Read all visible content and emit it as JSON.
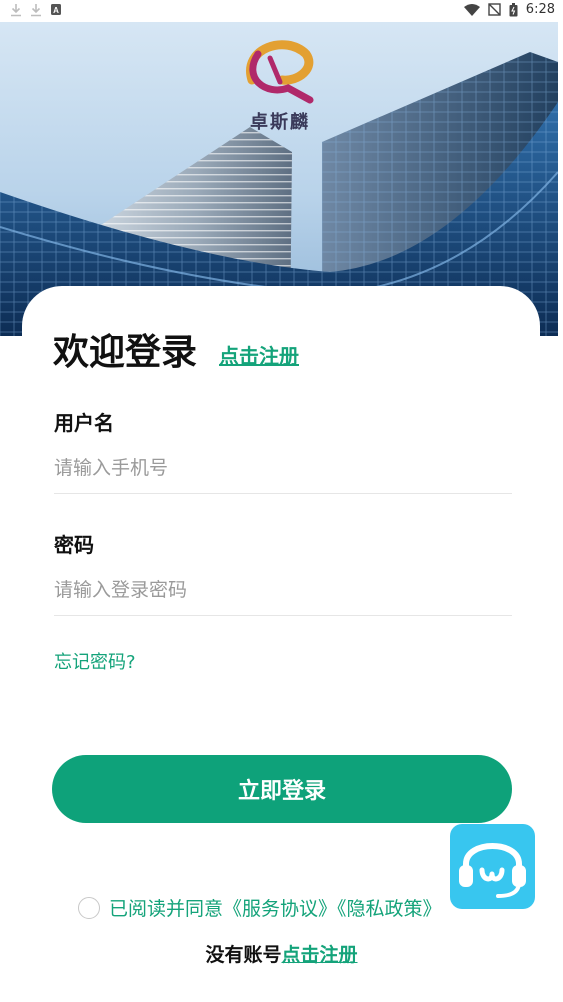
{
  "status_bar": {
    "time": "6:28",
    "left_icons": [
      "download-icon",
      "download-icon",
      "a-notification-icon"
    ],
    "right_icons": [
      "wifi-icon",
      "no-sim-icon",
      "battery-icon"
    ]
  },
  "hero": {
    "brand_name": "卓斯麟"
  },
  "login": {
    "title": "欢迎登录",
    "register_link": "点击注册",
    "username_label": "用户名",
    "username_placeholder": "请输入手机号",
    "password_label": "密码",
    "password_placeholder": "请输入登录密码",
    "forgot_password": "忘记密码?",
    "submit_label": "立即登录"
  },
  "agreement": {
    "text": "已阅读并同意《服务协议》《隐私政策》"
  },
  "footer": {
    "no_account": "没有账号",
    "register_link": "点击注册"
  },
  "colors": {
    "accent": "#0ea27a",
    "link": "#14a37a",
    "service_bg": "#38c6ef"
  }
}
